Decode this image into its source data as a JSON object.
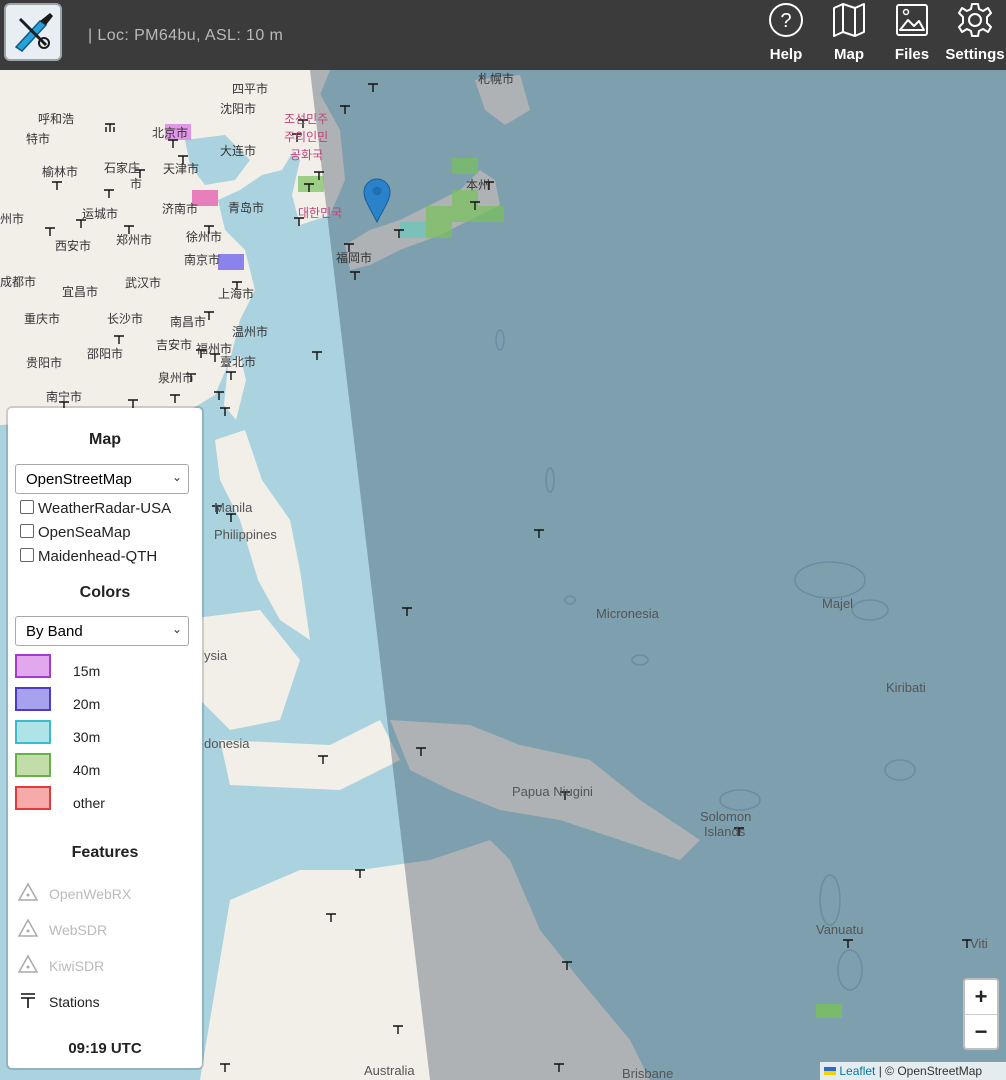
{
  "header": {
    "location_text": "| Loc: PM64bu, ASL: 10 m",
    "buttons": [
      {
        "label": "Help",
        "icon": "help-icon"
      },
      {
        "label": "Map",
        "icon": "map-icon"
      },
      {
        "label": "Files",
        "icon": "files-icon"
      },
      {
        "label": "Settings",
        "icon": "settings-icon"
      }
    ]
  },
  "map_labels": {
    "hohhot": "呼和浩",
    "baotou": "特市",
    "shenyang": "沈阳市",
    "siping": "四平市",
    "beijing": "北京市",
    "dalian": "大连市",
    "tianjin": "天津市",
    "shijiazhuang": "石家庄",
    "shi": "市",
    "yulin": "榆林市",
    "jinan": "济南市",
    "qingdao": "青岛市",
    "yuncheng": "运城市",
    "zhengzhou": "郑州市",
    "xuzhou": "徐州市",
    "xian": "西安市",
    "zhou": "州市",
    "nanjing": "南京市",
    "chengdu": "成都市",
    "yichang": "宜昌市",
    "wuhan": "武汉市",
    "shanghai": "上海市",
    "chongqing": "重庆市",
    "changsha": "长沙市",
    "nanchang": "南昌市",
    "wenzhou": "温州市",
    "shaoyang": "邵阳市",
    "jian": "吉安市",
    "guiyang": "贵阳市",
    "fuzhou": "福州市",
    "taipei": "臺北市",
    "quanzhou": "泉州市",
    "nanning": "南宁市",
    "fukuoka": "福岡市",
    "sapporo": "札幌市",
    "honshu": "本州",
    "nk1": "조선민주",
    "nk2": "주의인민",
    "nk3": "공화국",
    "sk": "대한민국",
    "manila": "Manila",
    "philippines": "Philippines",
    "micronesia": "Micronesia",
    "majel": "Majel",
    "kiribati": "Kiribati",
    "indonesia": "donesia",
    "ysia": "ysia",
    "papua": "Papua Niugini",
    "solomon1": "Solomon",
    "solomon2": "Islands",
    "vanuatu": "Vanuatu",
    "viti": "Viti",
    "australia": "Australia",
    "brisbane": "Brisbane"
  },
  "panel": {
    "map_title": "Map",
    "map_select": "OpenStreetMap",
    "overlays": [
      "WeatherRadar-USA",
      "OpenSeaMap",
      "Maidenhead-QTH"
    ],
    "colors_title": "Colors",
    "colors_select": "By Band",
    "legend": [
      {
        "label": "15m",
        "fill": "#e2a8ee",
        "border": "#a23bd0"
      },
      {
        "label": "20m",
        "fill": "#a8a2ee",
        "border": "#4b3dcc"
      },
      {
        "label": "30m",
        "fill": "#aee4e8",
        "border": "#3bbcc8"
      },
      {
        "label": "40m",
        "fill": "#c2dcaa",
        "border": "#6ab04a"
      },
      {
        "label": "other",
        "fill": "#f7aaaa",
        "border": "#e23b3b"
      }
    ],
    "features_title": "Features",
    "features": [
      {
        "label": "OpenWebRX",
        "icon": "openwebrx-icon",
        "color": "#bbbbbb"
      },
      {
        "label": "WebSDR",
        "icon": "websdr-icon",
        "color": "#bbbbbb"
      },
      {
        "label": "KiwiSDR",
        "icon": "kiwisdr-icon",
        "color": "#bbbbbb"
      },
      {
        "label": "Stations",
        "icon": "stations-icon",
        "color": "#222222"
      }
    ],
    "utc_time": "09:19 UTC"
  },
  "zoom": {
    "in": "+",
    "out": "−"
  },
  "attribution": {
    "leaflet": "Leaflet",
    "osm": "| © OpenStreetMap"
  }
}
